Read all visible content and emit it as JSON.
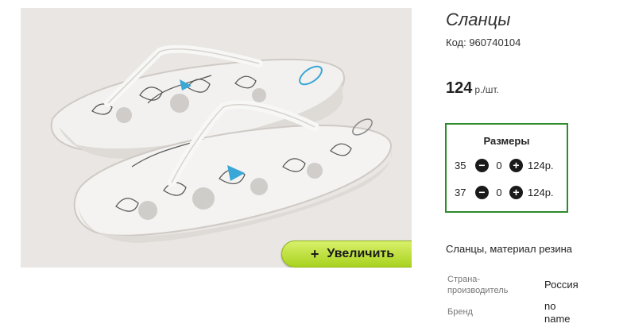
{
  "product": {
    "title": "Сланцы",
    "code": "Код: 960740104",
    "price_amount": "124",
    "price_unit": "р./шт.",
    "zoom_label": "Увеличить",
    "zoom_plus": "+",
    "description": "Сланцы, материал резина"
  },
  "sizes": {
    "title": "Размеры",
    "rows": [
      {
        "size": "35",
        "qty": "0",
        "price": "124р."
      },
      {
        "size": "37",
        "qty": "0",
        "price": "124р."
      }
    ],
    "minus_glyph": "−",
    "plus_glyph": "+"
  },
  "attributes": [
    {
      "label": "Страна-производитель",
      "label_line1": "Страна-",
      "label_line2": "производитель",
      "value": "Россия"
    },
    {
      "label": "Бренд",
      "value_line1": "no",
      "value_line2": "name"
    }
  ],
  "colors": {
    "zoom_button": "#a8d21f",
    "sizes_border": "#2e8b2e",
    "strap_accent": "#3aa7d6"
  }
}
